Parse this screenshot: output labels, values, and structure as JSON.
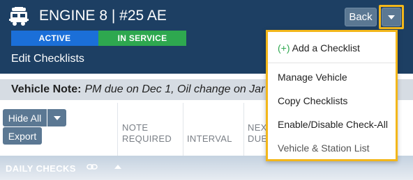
{
  "header": {
    "title": "ENGINE 8 | #25 AE",
    "status_active": "ACTIVE",
    "status_service": "IN SERVICE",
    "subtitle": "Edit Checklists",
    "back_label": "Back",
    "icon": "fire-truck-icon"
  },
  "vehicle_note": {
    "label": "Vehicle Note:",
    "text": "PM due on Dec 1, Oil change on Jar"
  },
  "toolbar": {
    "hide_all_label": "Hide All",
    "export_label": "Export"
  },
  "table": {
    "columns": [
      "NOTE",
      "REQUIRED",
      "INTERVAL",
      "NEX",
      "DUE"
    ]
  },
  "section": {
    "title": "DAILY CHECKS",
    "icon": "link-icon"
  },
  "dropdown": {
    "items": [
      {
        "prefix": "(+)",
        "label": "Add a Checklist"
      },
      {
        "label": "Manage Vehicle"
      },
      {
        "label": "Copy Checklists"
      },
      {
        "label": "Enable/Disable Check-All"
      },
      {
        "label": "Vehicle & Station List"
      }
    ]
  },
  "colors": {
    "header_bg": "#1d3f63",
    "active": "#1b6fd8",
    "in_service": "#2ea84f",
    "highlight": "#f3b71a",
    "button": "#5b7893"
  }
}
